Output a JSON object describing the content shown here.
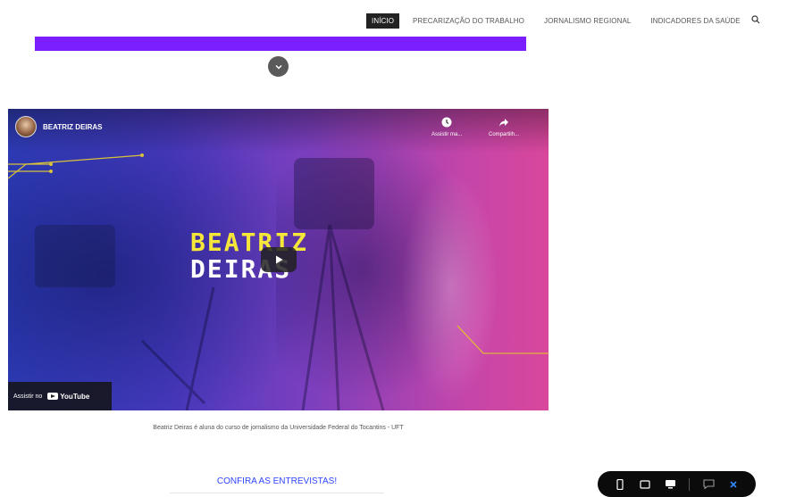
{
  "nav": {
    "items": [
      {
        "label": "INÍCIO",
        "active": true
      },
      {
        "label": "PRECARIZAÇÃO DO TRABALHO",
        "active": false
      },
      {
        "label": "JORNALISMO REGIONAL",
        "active": false
      },
      {
        "label": "INDICADORES DA SAÚDE",
        "active": false
      }
    ],
    "search_icon": "search-icon"
  },
  "colors": {
    "accent_bar": "#7b1fff",
    "link": "#2f45ff",
    "title_yellow": "#f5e63a"
  },
  "video": {
    "channel_name": "BEATRIZ DEIRAS",
    "watch_later_label": "Assistir ma...",
    "share_label": "Compartilh...",
    "title_line1": "BEATRIZ",
    "title_line2": "DEIRAS",
    "watch_on_label": "Assistir no",
    "youtube_label": "YouTube"
  },
  "caption": "Beatriz Deiras é aluna do curso de jornalismo da Universidade Federal do Tocantins - UFT",
  "cta": "CONFIRA AS ENTREVISTAS!",
  "device_bar": {
    "icons": [
      "mobile-icon",
      "tablet-icon",
      "desktop-icon",
      "comment-icon",
      "close-icon"
    ]
  }
}
